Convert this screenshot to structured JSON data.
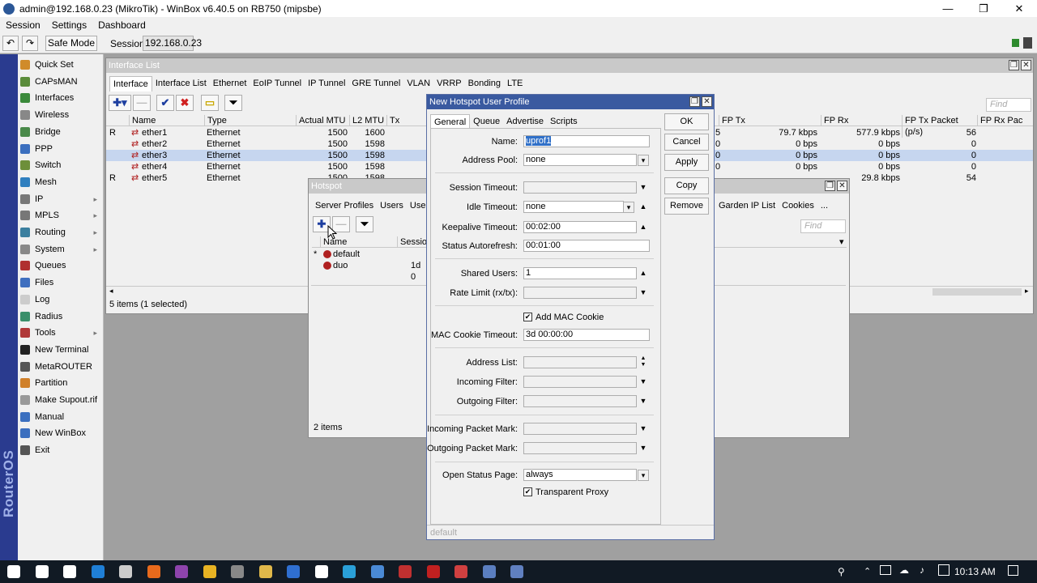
{
  "window": {
    "title": "admin@192.168.0.23 (MikroTik) - WinBox v6.40.5 on RB750 (mipsbe)",
    "minimize": "—",
    "maximize": "❐",
    "close": "✕"
  },
  "menu": [
    "Session",
    "Settings",
    "Dashboard"
  ],
  "toolbar": {
    "undo": "↶",
    "redo": "↷",
    "safe_mode": "Safe Mode",
    "session_label": "Session:",
    "session_value": "192.168.0.23"
  },
  "rail_text": "RouterOS WinBox",
  "sidebar": [
    {
      "label": "Quick Set",
      "color": "#d08b2a",
      "arrow": ""
    },
    {
      "label": "CAPsMAN",
      "color": "#5a8c3a",
      "arrow": ""
    },
    {
      "label": "Interfaces",
      "color": "#3b8a3b",
      "arrow": ""
    },
    {
      "label": "Wireless",
      "color": "#888888",
      "arrow": ""
    },
    {
      "label": "Bridge",
      "color": "#4a8a4a",
      "arrow": ""
    },
    {
      "label": "PPP",
      "color": "#3b6fbf",
      "arrow": ""
    },
    {
      "label": "Switch",
      "color": "#6d8f3a",
      "arrow": ""
    },
    {
      "label": "Mesh",
      "color": "#2f7fbf",
      "arrow": ""
    },
    {
      "label": "IP",
      "color": "#777777",
      "arrow": "▸"
    },
    {
      "label": "MPLS",
      "color": "#777777",
      "arrow": "▸"
    },
    {
      "label": "Routing",
      "color": "#3b7f9f",
      "arrow": "▸"
    },
    {
      "label": "System",
      "color": "#888888",
      "arrow": "▸"
    },
    {
      "label": "Queues",
      "color": "#b03030",
      "arrow": ""
    },
    {
      "label": "Files",
      "color": "#3f6fbf",
      "arrow": ""
    },
    {
      "label": "Log",
      "color": "#cccccc",
      "arrow": ""
    },
    {
      "label": "Radius",
      "color": "#3a8f6a",
      "arrow": ""
    },
    {
      "label": "Tools",
      "color": "#b03838",
      "arrow": "▸"
    },
    {
      "label": "New Terminal",
      "color": "#222222",
      "arrow": ""
    },
    {
      "label": "MetaROUTER",
      "color": "#555555",
      "arrow": ""
    },
    {
      "label": "Partition",
      "color": "#d0802a",
      "arrow": ""
    },
    {
      "label": "Make Supout.rif",
      "color": "#999999",
      "arrow": ""
    },
    {
      "label": "Manual",
      "color": "#3b6fbf",
      "arrow": ""
    },
    {
      "label": "New WinBox",
      "color": "#3b6fbf",
      "arrow": ""
    },
    {
      "label": "Exit",
      "color": "#555555",
      "arrow": ""
    }
  ],
  "interface_list": {
    "title": "Interface List",
    "tabs": [
      "Interface",
      "Interface List",
      "Ethernet",
      "EoIP Tunnel",
      "IP Tunnel",
      "GRE Tunnel",
      "VLAN",
      "VRRP",
      "Bonding",
      "LTE"
    ],
    "find": "Find",
    "columns": [
      "Name",
      "Type",
      "Actual MTU",
      "L2 MTU",
      "Tx"
    ],
    "right_columns": [
      "FP Tx",
      "FP Rx",
      "FP Tx Packet (p/s)",
      "FP Rx Pac"
    ],
    "rows": [
      {
        "flag": "R",
        "name": "ether1",
        "type": "Ethernet",
        "mtu": "1500",
        "l2mtu": "1600",
        "fptx": "79.7 kbps",
        "fprx": "577.9 kbps",
        "fptxp": "56",
        "part": "5"
      },
      {
        "flag": "",
        "name": "ether2",
        "type": "Ethernet",
        "mtu": "1500",
        "l2mtu": "1598",
        "fptx": "0 bps",
        "fprx": "0 bps",
        "fptxp": "0",
        "part": "0"
      },
      {
        "flag": "",
        "name": "ether3",
        "type": "Ethernet",
        "mtu": "1500",
        "l2mtu": "1598",
        "fptx": "0 bps",
        "fprx": "0 bps",
        "fptxp": "0",
        "part": "0"
      },
      {
        "flag": "",
        "name": "ether4",
        "type": "Ethernet",
        "mtu": "1500",
        "l2mtu": "1598",
        "fptx": "0 bps",
        "fprx": "0 bps",
        "fptxp": "0",
        "part": "0"
      },
      {
        "flag": "R",
        "name": "ether5",
        "type": "Ethernet",
        "mtu": "1500",
        "l2mtu": "1598",
        "fptx": "",
        "fprx": "29.8 kbps",
        "fptxp": "54",
        "part": ""
      }
    ],
    "status": "5 items (1 selected)"
  },
  "hotspot": {
    "title": "Hotspot",
    "tabs": [
      "Server Profiles",
      "Users",
      "User"
    ],
    "right_tabs": [
      "Garden IP List",
      "Cookies",
      "..."
    ],
    "find": "Find",
    "columns": [
      "Name",
      "Session"
    ],
    "rows": [
      {
        "marker": "*",
        "name": "default",
        "session": ""
      },
      {
        "marker": "",
        "name": "duo",
        "session": "1d 0"
      }
    ],
    "status": "2 items"
  },
  "dialog": {
    "title": "New Hotspot User Profile",
    "tabs": [
      "General",
      "Queue",
      "Advertise",
      "Scripts"
    ],
    "buttons": [
      "OK",
      "Cancel",
      "Apply",
      "Copy",
      "Remove"
    ],
    "fields": {
      "name_label": "Name:",
      "name_value": "uprof1",
      "address_pool_label": "Address Pool:",
      "address_pool_value": "none",
      "session_timeout_label": "Session Timeout:",
      "session_timeout_value": "",
      "idle_timeout_label": "Idle Timeout:",
      "idle_timeout_value": "none",
      "keepalive_label": "Keepalive Timeout:",
      "keepalive_value": "00:02:00",
      "status_autorefresh_label": "Status Autorefresh:",
      "status_autorefresh_value": "00:01:00",
      "shared_users_label": "Shared Users:",
      "shared_users_value": "1",
      "rate_limit_label": "Rate Limit (rx/tx):",
      "rate_limit_value": "",
      "add_mac_cookie_label": "Add MAC Cookie",
      "add_mac_cookie_checked": true,
      "mac_cookie_timeout_label": "MAC Cookie Timeout:",
      "mac_cookie_timeout_value": "3d 00:00:00",
      "address_list_label": "Address List:",
      "address_list_value": "",
      "incoming_filter_label": "Incoming Filter:",
      "incoming_filter_value": "",
      "outgoing_filter_label": "Outgoing Filter:",
      "outgoing_filter_value": "",
      "incoming_packet_mark_label": "Incoming Packet Mark:",
      "incoming_packet_mark_value": "",
      "outgoing_packet_mark_label": "Outgoing Packet Mark:",
      "outgoing_packet_mark_value": "",
      "open_status_page_label": "Open Status Page:",
      "open_status_page_value": "always",
      "transparent_proxy_label": "Transparent Proxy",
      "transparent_proxy_checked": true
    },
    "status": "default"
  },
  "taskbar": {
    "time": "10:13 AM",
    "icons": [
      "start-icon",
      "search-icon",
      "task-view-icon",
      "edge-icon",
      "store-icon",
      "firefox-icon",
      "app-icon",
      "chrome-icon",
      "app2-icon",
      "explorer-icon",
      "winbox-icon",
      "mail-icon",
      "photos-icon",
      "box-icon",
      "pdf-icon",
      "filezilla-icon",
      "app3-icon",
      "virtualbox-icon",
      "app4-icon"
    ]
  }
}
